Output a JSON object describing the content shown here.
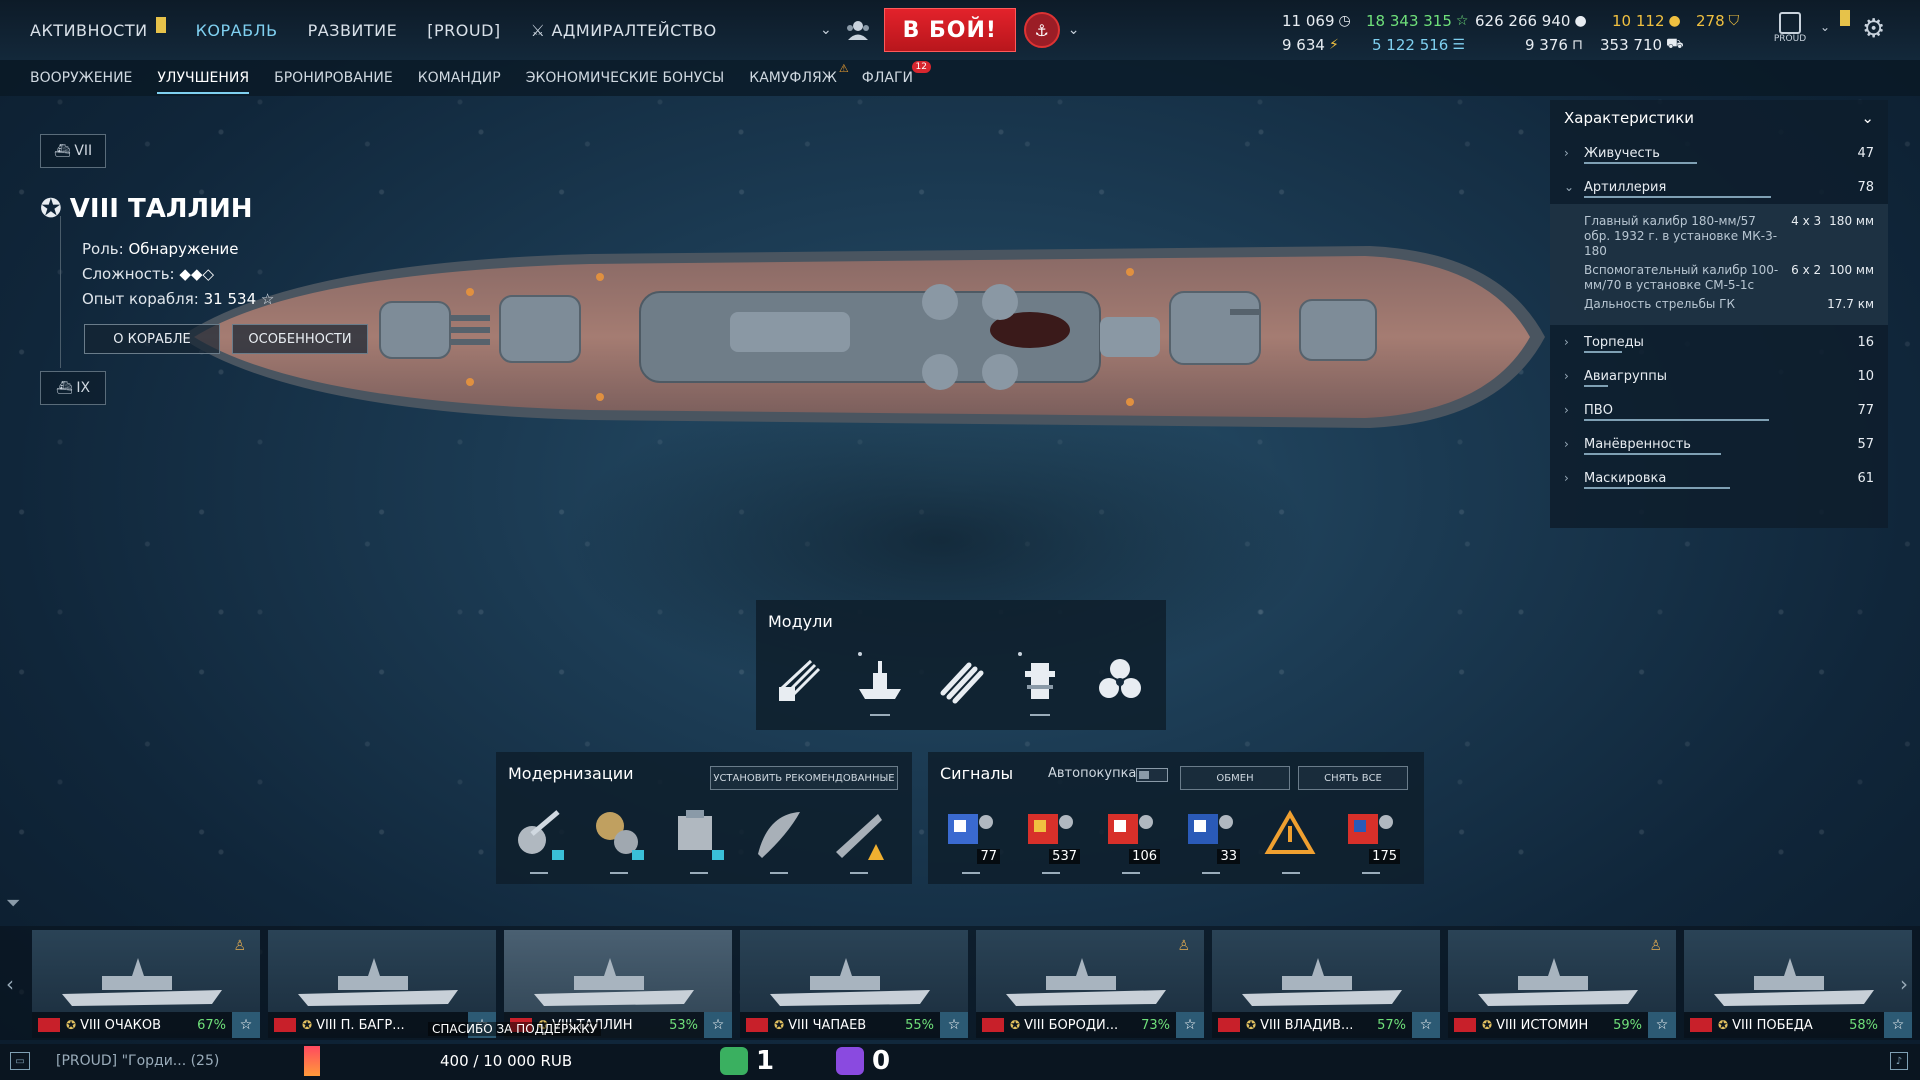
{
  "nav": {
    "items": [
      {
        "label": "АКТИВНОСТИ"
      },
      {
        "label": "КОРАБЛЬ"
      },
      {
        "label": "РАЗВИТИЕ"
      },
      {
        "label": "[PROUD]"
      },
      {
        "label": "АДМИРАЛТЕЙСТВО"
      }
    ],
    "active": "КОРАБЛЬ"
  },
  "battle_button": "В БОЙ!",
  "resources": {
    "credits_total": "11 069",
    "free_xp_total": "18 343 315",
    "silver": "626 266 940",
    "doubloons": "10 112",
    "premium": "278",
    "elite_xp": "9 634",
    "coal": "5 122 516",
    "steel": "9 376",
    "research": "353 710"
  },
  "profile_label": "PROUD",
  "subtabs": {
    "items": [
      {
        "label": "ВООРУЖЕНИЕ"
      },
      {
        "label": "УЛУЧШЕНИЯ"
      },
      {
        "label": "БРОНИРОВАНИЕ"
      },
      {
        "label": "КОМАНДИР"
      },
      {
        "label": "ЭКОНОМИЧЕСКИЕ БОНУСЫ"
      },
      {
        "label": "КАМУФЛЯЖ"
      },
      {
        "label": "ФЛАГИ"
      }
    ],
    "flags_badge": "12"
  },
  "ship": {
    "prev_tier": "VII",
    "next_tier": "IX",
    "name": "VIII ТАЛЛИН",
    "role_label": "Роль:",
    "role": "Обнаружение",
    "difficulty_label": "Сложность:",
    "difficulty": "◆◆◇",
    "xp_label": "Опыт корабля:",
    "xp": "31 534",
    "about_button": "О КОРАБЛЕ",
    "features_button": "ОСОБЕННОСТИ"
  },
  "characteristics": {
    "title": "Характеристики",
    "rows": [
      {
        "label": "Живучесть",
        "value": "47",
        "level": 47
      },
      {
        "label": "Артиллерия",
        "value": "78",
        "level": 78
      },
      {
        "label": "Торпеды",
        "value": "16",
        "level": 16
      },
      {
        "label": "Авиагруппы",
        "value": "10",
        "level": 10
      },
      {
        "label": "ПВО",
        "value": "77",
        "level": 77
      },
      {
        "label": "Манёвренность",
        "value": "57",
        "level": 57
      },
      {
        "label": "Маскировка",
        "value": "61",
        "level": 61
      }
    ],
    "artillery_details": [
      {
        "label": "Главный калибр 180-мм/57 обр. 1932 г. в установке МК-3-180",
        "count": "4 x 3",
        "value": "180 мм"
      },
      {
        "label": "Вспомогательный калибр 100-мм/70 в установке СМ-5-1с",
        "count": "6 x 2",
        "value": "100 мм"
      },
      {
        "label": "Дальность стрельбы ГК",
        "count": "",
        "value": "17.7 км"
      }
    ]
  },
  "modules": {
    "title": "Модули",
    "items": [
      "main-battery-icon",
      "hull-icon",
      "torpedo-icon",
      "fire-control-icon",
      "engine-icon"
    ]
  },
  "upgrades": {
    "title": "Модернизации",
    "install_button": "УСТАНОВИТЬ РЕКОМЕНДОВАННЫЕ"
  },
  "signals": {
    "title": "Сигналы",
    "autobuy_label": "Автопокупка",
    "exchange_button": "ОБМЕН",
    "remove_button": "СНЯТЬ ВСЕ",
    "items": [
      {
        "icon": "signal-flag-icon",
        "count": "77"
      },
      {
        "icon": "signal-flag-icon",
        "count": "537"
      },
      {
        "icon": "signal-flag-icon",
        "count": "106"
      },
      {
        "icon": "signal-flag-icon",
        "count": "33"
      },
      {
        "icon": "warning-icon",
        "count": ""
      },
      {
        "icon": "signal-flag-icon",
        "count": "175"
      }
    ]
  },
  "carousel": {
    "ships": [
      {
        "name": "VIII ОЧАКОВ",
        "pct": "67%",
        "locked": true
      },
      {
        "name": "VIII П. БАГР...",
        "pct": "",
        "locked": false
      },
      {
        "name": "VIII ТАЛЛИН",
        "pct": "53%",
        "locked": false,
        "active": true
      },
      {
        "name": "VIII ЧАПАЕВ",
        "pct": "55%",
        "locked": false
      },
      {
        "name": "VIII БОРОДИ...",
        "pct": "73%",
        "locked": true
      },
      {
        "name": "VIII ВЛАДИВ...",
        "pct": "57%",
        "locked": false
      },
      {
        "name": "VIII ИСТОМИН",
        "pct": "59%",
        "locked": true
      },
      {
        "name": "VIII ПОБЕДА",
        "pct": "58%",
        "locked": false
      }
    ]
  },
  "bottom": {
    "clan_text": "[PROUD] \"Горди...  (25)",
    "thanks_text": "СПАСИБО ЗА ПОДДЕРЖКУ",
    "donate_text": "400 / 10 000 RUB",
    "counter_a": "1",
    "counter_b": "0"
  }
}
